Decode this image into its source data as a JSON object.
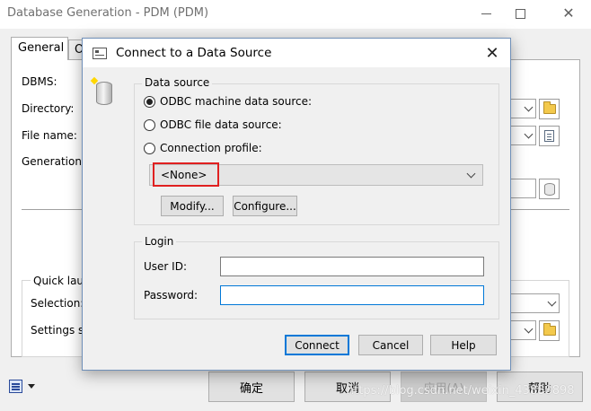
{
  "background_window": {
    "title": "Database Generation - PDM (PDM)",
    "tabs": [
      {
        "label": "General"
      },
      {
        "label": "O"
      }
    ],
    "labels": {
      "dbms": "DBMS:",
      "directory": "Directory:",
      "file_name": "File name:",
      "generation_type": "Generation ty",
      "quick_launch": "Quick laun",
      "selection": "Selection:",
      "settings_set": "Settings se"
    },
    "buttons": {
      "ok": "确定",
      "cancel": "取消",
      "apply": "应用(A)",
      "help": "帮助"
    },
    "watermark": "https://blog.csdn.net/weixin_43888898"
  },
  "dialog": {
    "title": "Connect to a Data Source",
    "data_source": {
      "group_title": "Data source",
      "options": [
        {
          "label": "ODBC machine data source:",
          "checked": true
        },
        {
          "label": "ODBC file data source:",
          "checked": false
        },
        {
          "label": "Connection profile:",
          "checked": false
        }
      ],
      "selected_source": "<None>",
      "modify_label": "Modify...",
      "configure_label": "Configure..."
    },
    "login": {
      "group_title": "Login",
      "user_id_label": "User ID:",
      "user_id_value": "",
      "password_label": "Password:",
      "password_value": ""
    },
    "buttons": {
      "connect": "Connect",
      "cancel": "Cancel",
      "help": "Help"
    }
  },
  "colors": {
    "highlight_box": "#e02020",
    "focus_border": "#0078d7"
  }
}
